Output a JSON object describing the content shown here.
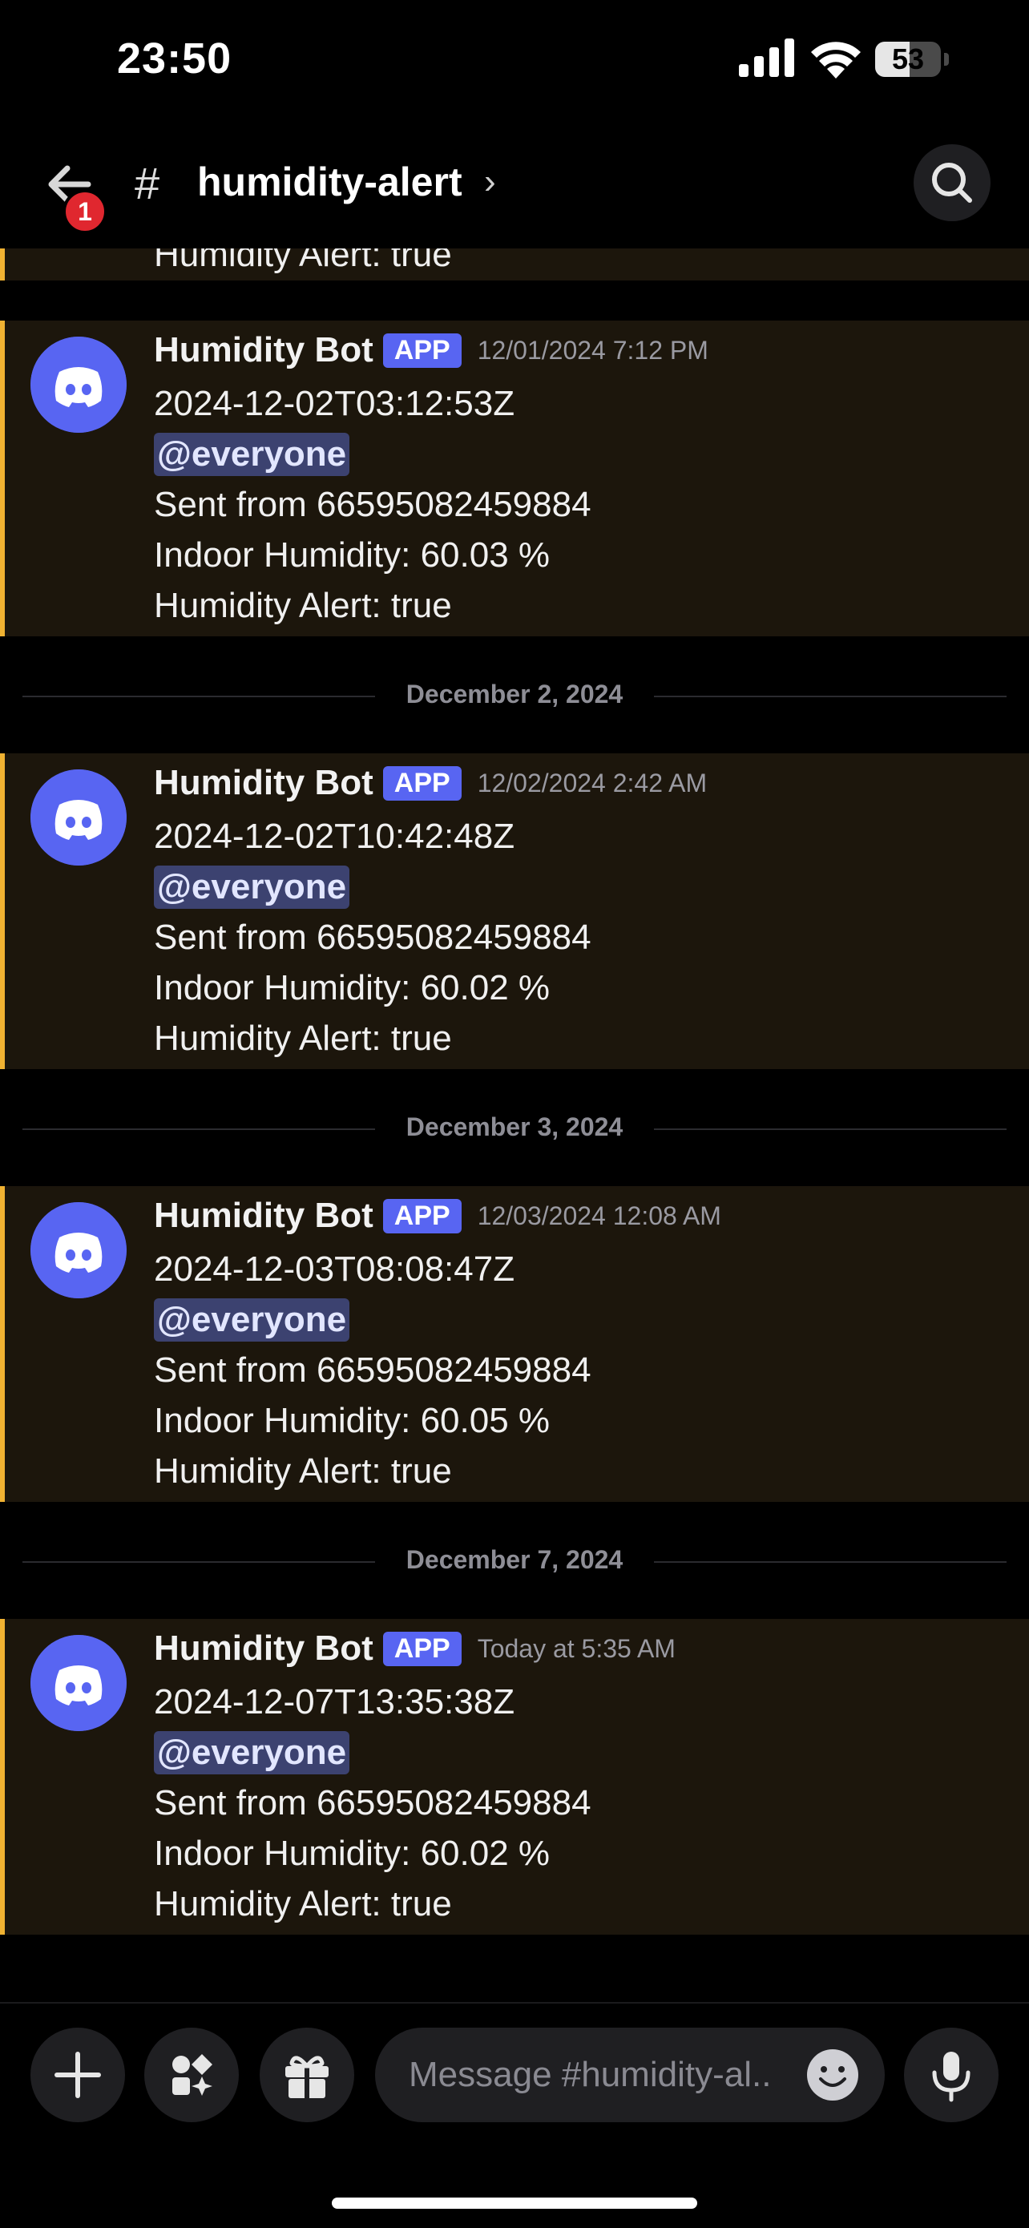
{
  "status_bar": {
    "time": "23:50",
    "battery": "53",
    "battery_level": 0.53
  },
  "header": {
    "channel_name": "humidity-alert",
    "notification_count": "1"
  },
  "partial_top_line": "Humidity Alert: true",
  "messages": [
    {
      "author": "Humidity Bot",
      "badge": "APP",
      "timestamp": "12/01/2024 7:12 PM",
      "line1": "2024-12-02T03:12:53Z",
      "mention": "@everyone",
      "line3": "Sent from 66595082459884",
      "line4": "Indoor Humidity: 60.03 %",
      "line5": "Humidity Alert: true"
    },
    {
      "author": "Humidity Bot",
      "badge": "APP",
      "timestamp": "12/02/2024 2:42 AM",
      "line1": "2024-12-02T10:42:48Z",
      "mention": "@everyone",
      "line3": "Sent from 66595082459884",
      "line4": "Indoor Humidity: 60.02 %",
      "line5": "Humidity Alert: true"
    },
    {
      "author": "Humidity Bot",
      "badge": "APP",
      "timestamp": "12/03/2024 12:08 AM",
      "line1": "2024-12-03T08:08:47Z",
      "mention": "@everyone",
      "line3": "Sent from 66595082459884",
      "line4": "Indoor Humidity: 60.05 %",
      "line5": "Humidity Alert: true"
    },
    {
      "author": "Humidity Bot",
      "badge": "APP",
      "timestamp": "Today at 5:35 AM",
      "line1": "2024-12-07T13:35:38Z",
      "mention": "@everyone",
      "line3": "Sent from 66595082459884",
      "line4": "Indoor Humidity: 60.02 %",
      "line5": "Humidity Alert: true"
    }
  ],
  "date_separators": [
    "December 2, 2024",
    "December 3, 2024",
    "December 7, 2024"
  ],
  "composer": {
    "placeholder": "Message #humidity-al.."
  },
  "colors": {
    "accent": "#5865f2",
    "highlight_border": "#f0b232",
    "highlight_bg": "#1c160c",
    "badge_red": "#e0272f"
  },
  "icons": {
    "back": "arrow-left-icon",
    "search": "search-icon",
    "add": "plus-icon",
    "apps": "apps-icon",
    "gift": "gift-icon",
    "emoji": "emoji-icon",
    "mic": "microphone-icon",
    "avatar": "discord-logo-icon"
  }
}
